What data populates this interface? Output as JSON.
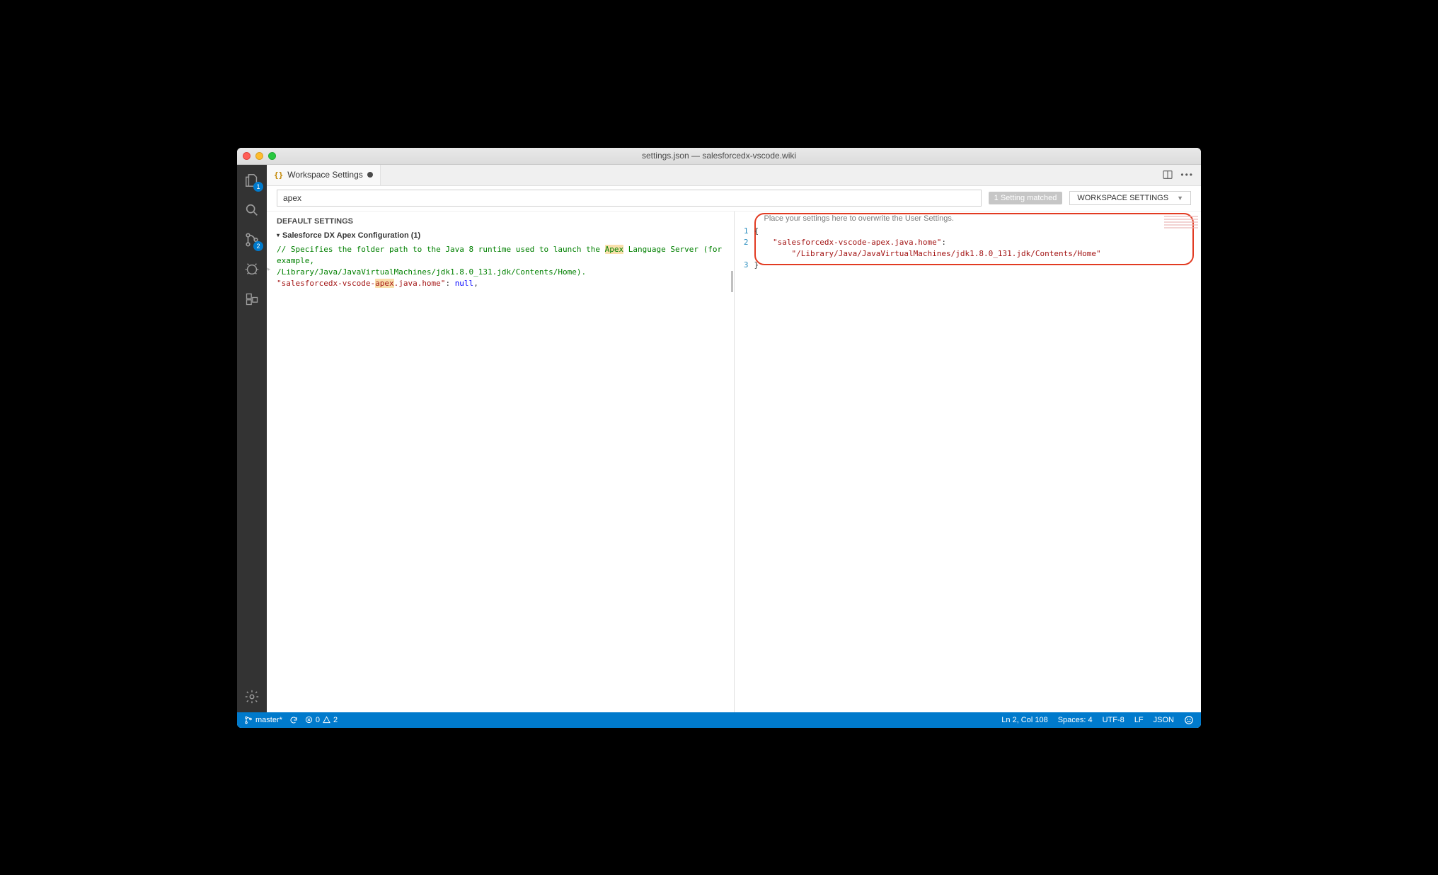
{
  "window": {
    "title": "settings.json — salesforcedx-vscode.wiki"
  },
  "activity": {
    "explorer_badge": "1",
    "scm_badge": "2"
  },
  "tab": {
    "label": "Workspace Settings"
  },
  "search": {
    "value": "apex",
    "match_label": "1 Setting matched",
    "scope_label": "WORKSPACE SETTINGS"
  },
  "left": {
    "heading": "DEFAULT SETTINGS",
    "category": "Salesforce DX Apex Configuration (1)",
    "comment_line1": "// Specifies the folder path to the Java 8 runtime used to launch the ",
    "comment_hl1": "Apex",
    "comment_line1b": " Language Server (for example,",
    "comment_line2": "/Library/Java/JavaVirtualMachines/jdk1.8.0_131.jdk/Contents/Home).",
    "setting_key_pre": "\"salesforcedx-vscode-",
    "setting_key_hl": "apex",
    "setting_key_post": ".java.home\"",
    "setting_value": "null"
  },
  "right": {
    "hint": "Place your settings here to overwrite the User Settings.",
    "line_numbers": [
      "1",
      "2",
      "3"
    ],
    "l1": "{",
    "l2_key": "\"salesforcedx-vscode-apex.java.home\"",
    "l2_colon": ":",
    "l2_val": "\"/Library/Java/JavaVirtualMachines/jdk1.8.0_131.jdk/Contents/Home\"",
    "l3": "}"
  },
  "status": {
    "branch": "master*",
    "errors": "0",
    "warnings": "2",
    "position": "Ln 2, Col 108",
    "spaces": "Spaces: 4",
    "encoding": "UTF-8",
    "eol": "LF",
    "language": "JSON"
  }
}
